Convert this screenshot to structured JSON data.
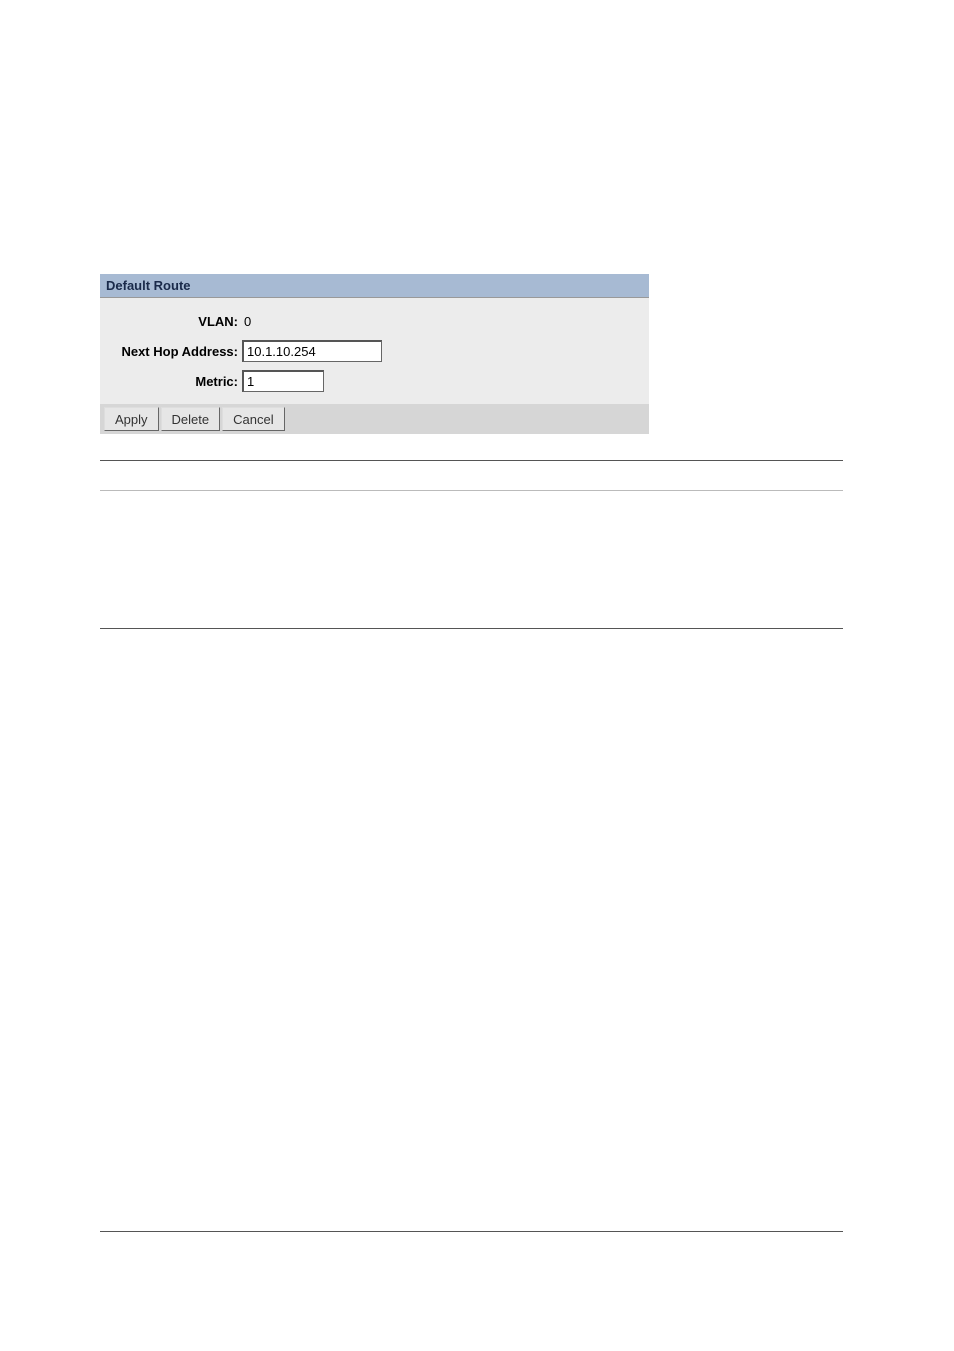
{
  "panel": {
    "title": "Default Route",
    "vlan_label": "VLAN:",
    "vlan_value": "0",
    "nexthop_label": "Next Hop Address:",
    "nexthop_value": "10.1.10.254",
    "metric_label": "Metric:",
    "metric_value": "1"
  },
  "buttons": {
    "apply": "Apply",
    "delete": "Delete",
    "cancel": "Cancel"
  }
}
